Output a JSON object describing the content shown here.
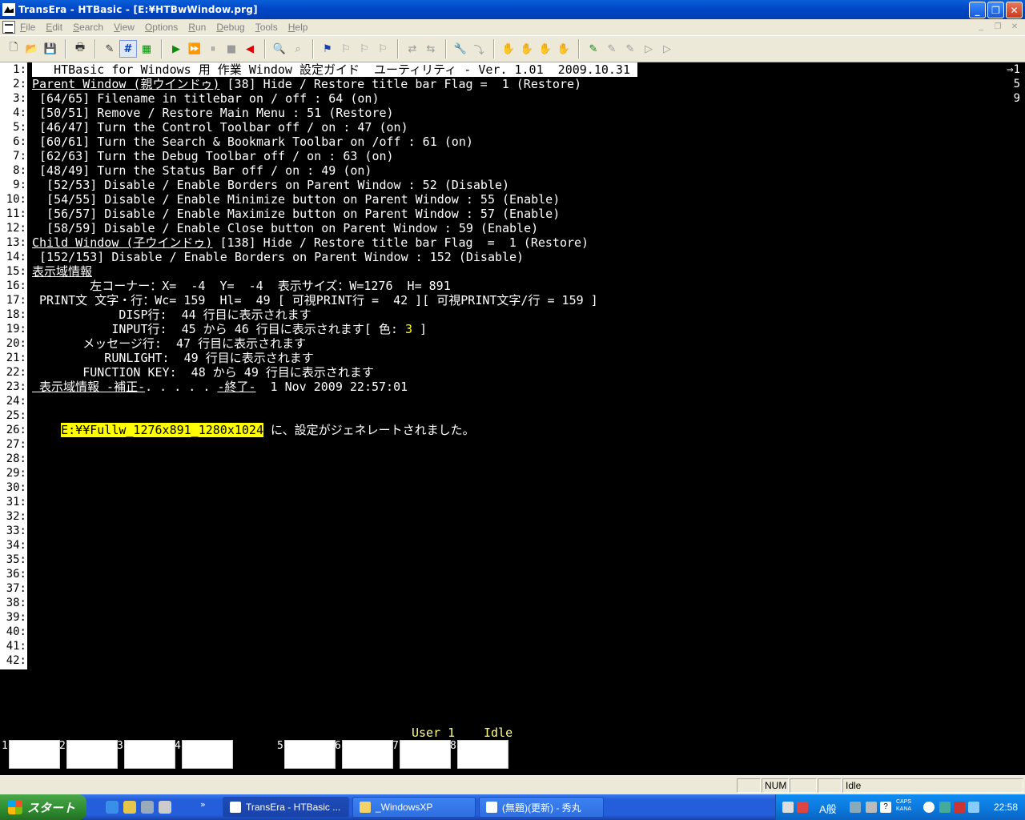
{
  "window": {
    "title": "TransEra - HTBasic - [E:¥HTBwWindow.prg]",
    "caption_buttons": [
      "_",
      "❐",
      "✕"
    ]
  },
  "menu": {
    "items": [
      "File",
      "Edit",
      "Search",
      "View",
      "Options",
      "Run",
      "Debug",
      "Tools",
      "Help"
    ]
  },
  "toolbar": {
    "icons": [
      "new-icon",
      "open-icon",
      "save-icon",
      "print-icon",
      "edit-icon",
      "hash-icon",
      "debug-icon",
      "run-icon",
      "continue-icon",
      "pause-icon",
      "stop-icon",
      "reset-icon",
      "find-icon",
      "find-next-icon",
      "bookmark-icon",
      "bookmark-next-icon",
      "bookmark-prev-icon",
      "bookmark-clear-icon",
      "replace-icon",
      "replace-all-icon",
      "settings-icon",
      "step-icon",
      "hand-icon",
      "breakpoint-icon",
      "watch-icon",
      "stack-icon",
      "trace-icon",
      "trace2-icon",
      "trace3-icon",
      "trace4-icon",
      "trace5-icon"
    ]
  },
  "crt": {
    "lines": [
      {
        "n": "1:",
        "t": "   HTBasic for Windows 用 作業 Window 設定ガイド  ユーティリティ - Ver. 1.01  2009.10.31 ",
        "style": "inv"
      },
      {
        "n": "2:",
        "t": "Parent Window (親ウインドゥ)",
        "t2": " [38] Hide / Restore title bar Flag =  1 (Restore)",
        "style": "ul-first"
      },
      {
        "n": "3:",
        "t": " [64/65] Filename in titlebar on / off : 64 (on)"
      },
      {
        "n": "4:",
        "t": " [50/51] Remove / Restore Main Menu : 51 (Restore)"
      },
      {
        "n": "5:",
        "t": " [46/47] Turn the Control Toolbar off / on : 47 (on)"
      },
      {
        "n": "6:",
        "t": " [60/61] Turn the Search & Bookmark Toolbar on /off : 61 (on)"
      },
      {
        "n": "7:",
        "t": " [62/63] Turn the Debug Toolbar off / on : 63 (on)"
      },
      {
        "n": "8:",
        "t": " [48/49] Turn the Status Bar off / on : 49 (on)"
      },
      {
        "n": "9:",
        "t": "  [52/53] Disable / Enable Borders on Parent Window : 52 (Disable)"
      },
      {
        "n": "10:",
        "t": "  [54/55] Disable / Enable Minimize button on Parent Window : 55 (Enable)"
      },
      {
        "n": "11:",
        "t": "  [56/57] Disable / Enable Maximize button on Parent Window : 57 (Enable)"
      },
      {
        "n": "12:",
        "t": "  [58/59] Disable / Enable Close button on Parent Window : 59 (Enable)"
      },
      {
        "n": "13:",
        "t": "Child Window (子ウインドゥ)",
        "t2": " [138] Hide / Restore title bar Flag  =  1 (Restore)",
        "style": "ul-first"
      },
      {
        "n": "14:",
        "t": " [152/153] Disable / Enable Borders on Parent Window : 152 (Disable)"
      },
      {
        "n": "15:",
        "t": "表示域情報",
        "style": "ul"
      },
      {
        "n": "16:",
        "t": "        左コーナー：X=  -4  Y=  -4  表示サイズ：W=1276  H= 891"
      },
      {
        "n": "17:",
        "t": " PRINT文 文字・行：Wc= 159  Hl=  49 [ 可視PRINT行 =  42 ][ 可視PRINT文字/行 = 159 ]"
      },
      {
        "n": "18:",
        "t": "            DISP行:  44 行目に表示されます"
      },
      {
        "n": "19:",
        "t": "           INPUT行:  45 から 46 行目に表示されます[ 色: ",
        "t3": "3",
        "t4": " ]"
      },
      {
        "n": "20:",
        "t": "       メッセージ行:  47 行目に表示されます"
      },
      {
        "n": "21:",
        "t": "          RUNLIGHT:  49 行目に表示されます"
      },
      {
        "n": "22:",
        "t": "       FUNCTION KEY:  48 から 49 行目に表示されます"
      },
      {
        "n": "23:",
        "t": " 表示域情報 -補正-",
        "t2": ". . . . . ",
        "t5": "-終了-",
        "t6": "  1 Nov 2009 22:57:01",
        "style": "ul-mixed"
      },
      {
        "n": "24:",
        "t": ""
      },
      {
        "n": "25:",
        "t": ""
      },
      {
        "n": "26:",
        "t": "    ",
        "t3": "E:¥¥Fullw_1276x891_1280x1024",
        "t4": " に、設定がジェネレートされました。",
        "style": "hl-mid"
      },
      {
        "n": "27:",
        "t": ""
      },
      {
        "n": "28:",
        "t": ""
      },
      {
        "n": "29:",
        "t": ""
      },
      {
        "n": "30:",
        "t": ""
      },
      {
        "n": "31:",
        "t": ""
      },
      {
        "n": "32:",
        "t": ""
      },
      {
        "n": "33:",
        "t": ""
      },
      {
        "n": "34:",
        "t": ""
      },
      {
        "n": "35:",
        "t": ""
      },
      {
        "n": "36:",
        "t": ""
      },
      {
        "n": "37:",
        "t": ""
      },
      {
        "n": "38:",
        "t": ""
      },
      {
        "n": "39:",
        "t": ""
      },
      {
        "n": "40:",
        "t": ""
      },
      {
        "n": "41:",
        "t": ""
      },
      {
        "n": "42:",
        "t": ""
      }
    ],
    "right_marks": [
      "⇒1",
      "5",
      "9"
    ],
    "user_label": "User 1",
    "run_status": "Idle",
    "softkey_numbers": [
      "1",
      "2",
      "3",
      "4",
      "5",
      "6",
      "7",
      "8"
    ]
  },
  "statusbar": {
    "num": "NUM",
    "state": "Idle"
  },
  "taskbar": {
    "start_label": "スタート",
    "tasks": [
      {
        "label": "TransEra - HTBasic ...",
        "active": true
      },
      {
        "label": "_WindowsXP",
        "active": false
      },
      {
        "label": "(無題)(更新) - 秀丸",
        "active": false
      }
    ],
    "ime": "A般",
    "caps": "CAPS",
    "kana": "KANA",
    "clock": "22:58"
  }
}
